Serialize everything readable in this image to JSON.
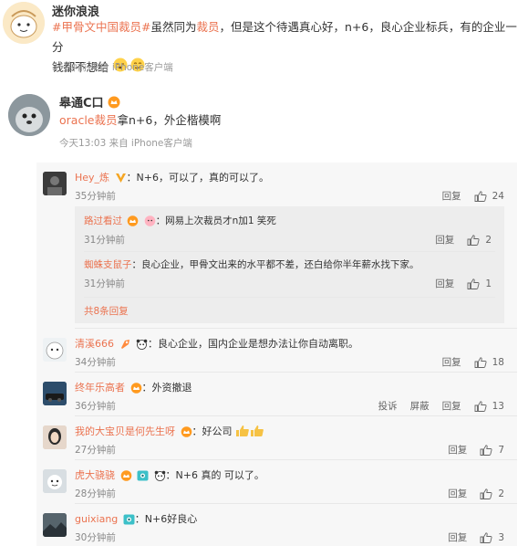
{
  "post1": {
    "username": "迷你浪浪",
    "hashtag1": "#甲骨文中国裁员#",
    "text_a": "虽然同为",
    "link_word": "裁员",
    "text_b": "，但是这个待遇真心好，n+6，良心企业标兵，有的企业一分",
    "text_c": "钱都不想给",
    "time": "3分钟前 来自 iPhone客户端"
  },
  "post2": {
    "username": "皋通C口",
    "link": "oracle裁员",
    "text": "拿n+6，外企楷模啊",
    "time": "今天13:03 来自 iPhone客户端"
  },
  "comments": [
    {
      "name": "Hey_炼",
      "text": "：N+6，可以了，真的可以了。",
      "time": "35分钟前",
      "reply": "回复",
      "likes": "24"
    },
    {
      "name": "清溪666",
      "text": "：良心企业，国内企业是想办法让你自动离职。",
      "time": "34分钟前",
      "reply": "回复",
      "likes": "18"
    },
    {
      "name": "终年乐高者",
      "text": "：外资撤退",
      "time": "36分钟前",
      "report": "投诉",
      "block": "屏蔽",
      "reply": "回复",
      "likes": "13"
    },
    {
      "name": "我的大宝贝是何先生呀",
      "text": "：好公司",
      "time": "27分钟前",
      "reply": "回复",
      "likes": "7"
    },
    {
      "name": "虎大骁骁",
      "text": "：N+6 真的 可以了。",
      "time": "28分钟前",
      "reply": "回复",
      "likes": "2"
    },
    {
      "name": "guixiang",
      "text": "：N+6好良心",
      "time": "30分钟前",
      "reply": "回复",
      "likes": "3"
    }
  ],
  "subcomments": [
    {
      "name": "路过看过",
      "text": "：网易上次裁员才n加1 笑死",
      "time": "31分钟前",
      "reply": "回复",
      "likes": "2"
    },
    {
      "name": "蜘蛛支鼠子",
      "text": "：良心企业，甲骨文出来的水平都不差，还白给你半年薪水找下家。",
      "time": "31分钟前",
      "reply": "回复",
      "likes": "1"
    }
  ],
  "more_replies": "共8条回复",
  "colors": {
    "accent": "#eb7350",
    "meta": "#999999",
    "panel": "#f7f7f7"
  }
}
